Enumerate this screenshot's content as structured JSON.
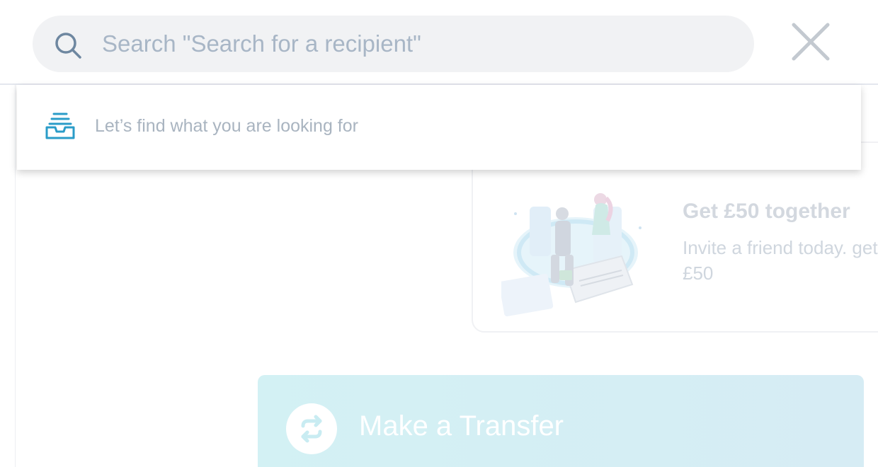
{
  "search": {
    "placeholder": "Search \"Search for a recipient\"",
    "value": ""
  },
  "dropdown": {
    "hint": "Let’s find what you are looking for"
  },
  "referral_card": {
    "title": "Get £50 together",
    "body": "Invite a friend today. get £50"
  },
  "transfer": {
    "label": "Make a Transfer"
  },
  "icons": {
    "search": "search-icon",
    "close": "close-icon",
    "inbox": "inbox-icon",
    "transfer": "transfer-arrows-icon"
  },
  "colors": {
    "accent": "#2a9cc8",
    "search_bg": "#f1f2f4",
    "placeholder": "#a8b6c6",
    "transfer_bg": "#d3f1f4"
  }
}
